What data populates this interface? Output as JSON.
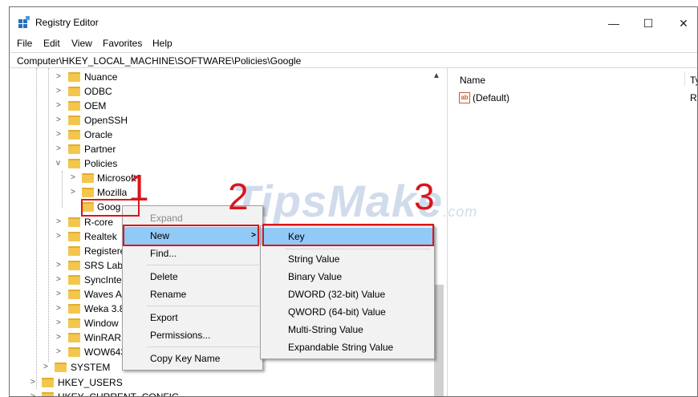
{
  "window": {
    "title": "Registry Editor",
    "controls": {
      "minimize": "—",
      "maximize": "☐",
      "close": "✕"
    }
  },
  "menubar": [
    "File",
    "Edit",
    "View",
    "Favorites",
    "Help"
  ],
  "address": "Computer\\HKEY_LOCAL_MACHINE\\SOFTWARE\\Policies\\Google",
  "tree": {
    "level1": [
      "Nuance",
      "ODBC",
      "OEM",
      "OpenSSH",
      "Oracle",
      "Partner",
      "Policies"
    ],
    "policies_children": [
      "Microsoft",
      "Mozilla",
      "Goog"
    ],
    "level1_after": [
      "R-core",
      "Realtek",
      "Registere",
      "SRS Labs",
      "SyncInte",
      "Waves A",
      "Weka 3.8",
      "Window",
      "WinRAR",
      "WOW643"
    ],
    "level0": [
      "SYSTEM"
    ],
    "roots": [
      "HKEY_USERS",
      "HKEY_CURRENT_CONFIG"
    ]
  },
  "right_pane": {
    "columns": {
      "name": "Name",
      "type": "Ty"
    },
    "rows": [
      {
        "name": "(Default)",
        "type": "R"
      }
    ]
  },
  "context_menu": {
    "items": [
      "Expand",
      "New",
      "Find...",
      "Delete",
      "Rename",
      "Export",
      "Permissions...",
      "Copy Key Name"
    ]
  },
  "submenu": {
    "items": [
      "Key",
      "String Value",
      "Binary Value",
      "DWORD (32-bit) Value",
      "QWORD (64-bit) Value",
      "Multi-String Value",
      "Expandable String Value"
    ]
  },
  "step_numbers": [
    "1",
    "2",
    "3"
  ],
  "watermark": {
    "text": "TipsMake",
    "suffix": ".com"
  },
  "colors": {
    "highlight": "#91c9f7",
    "annotation_red": "#d9161c",
    "folder": "#f3c64e"
  }
}
